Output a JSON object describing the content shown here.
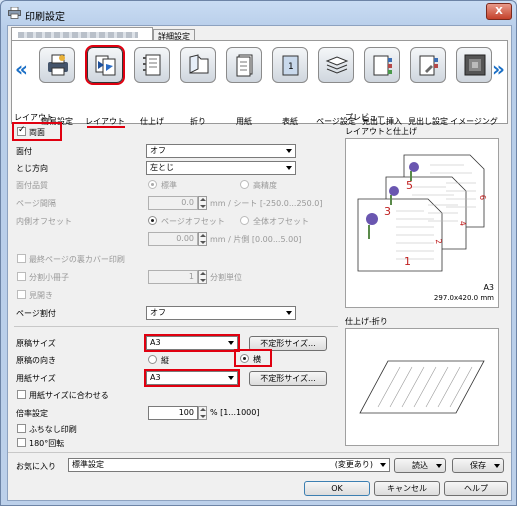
{
  "window": {
    "title": "印刷設定",
    "close": "X"
  },
  "tabs": [
    "",
    "詳細設定"
  ],
  "categories": [
    {
      "label": "簡易設定"
    },
    {
      "label": "レイアウト"
    },
    {
      "label": "仕上げ"
    },
    {
      "label": "折り"
    },
    {
      "label": "用紙"
    },
    {
      "label": "表紙"
    },
    {
      "label": "ページ設定"
    },
    {
      "label": "見出し挿入"
    },
    {
      "label": "見出し設定"
    },
    {
      "label": "イメージング"
    }
  ],
  "nav": {
    "prev": "«",
    "next": "»"
  },
  "layout": {
    "section": "レイアウト",
    "duplex": "両面",
    "binding_side_label": "面付",
    "binding_side_value": "オフ",
    "binding_dir_label": "とじ方向",
    "binding_dir_value": "左とじ",
    "quality_label": "面付品質",
    "quality_standard": "標準",
    "quality_high": "高精度",
    "page_spacing_label": "ページ間隔",
    "page_spacing_value": "0.0",
    "page_spacing_unit": "mm / シート [-250.0...250.0]",
    "inner_offset_label": "内側オフセット",
    "offset_page": "ページオフセット",
    "offset_all": "全体オフセット",
    "offset_value": "0.00",
    "offset_unit": "mm / 片側 [0.00...5.00]",
    "last_page_cover": "最終ページの裏カバー印刷",
    "split_booklet": "分割小冊子",
    "split_value": "1",
    "split_unit": "分割単位",
    "spread": "見開き",
    "page_split_label": "ページ割付",
    "page_split_value": "オフ"
  },
  "paper": {
    "original_size_label": "原稿サイズ",
    "original_size_value": "A3",
    "custom_size_button": "不定形サイズ...",
    "orientation_label": "原稿の向き",
    "portrait": "縦",
    "landscape": "横",
    "paper_size_label": "用紙サイズ",
    "paper_size_value": "A3",
    "custom_size_button2": "不定形サイズ...",
    "fit_to_paper": "用紙サイズに合わせる",
    "scale_label": "倍率設定",
    "scale_value": "100",
    "scale_unit": "% [1...1000]",
    "borderless": "ふちなし印刷",
    "rotate180": "180°回転"
  },
  "preview": {
    "title": "プレビュー",
    "subtitle": "レイアウトと仕上げ",
    "page_numbers": [
      "5",
      "6",
      "3",
      "4",
      "1",
      "2"
    ],
    "size": "A3",
    "dimensions": "297.0x420.0 mm",
    "finish_title": "仕上げ-折り"
  },
  "favorites": {
    "label": "お気に入り",
    "value": "標準設定",
    "changed": "(変更あり)",
    "load": "読込",
    "save": "保存"
  },
  "footer": {
    "ok": "OK",
    "cancel": "キャンセル",
    "help": "ヘルプ"
  },
  "colors": {
    "highlight": "#e00010",
    "accent": "#1a6fc6"
  }
}
